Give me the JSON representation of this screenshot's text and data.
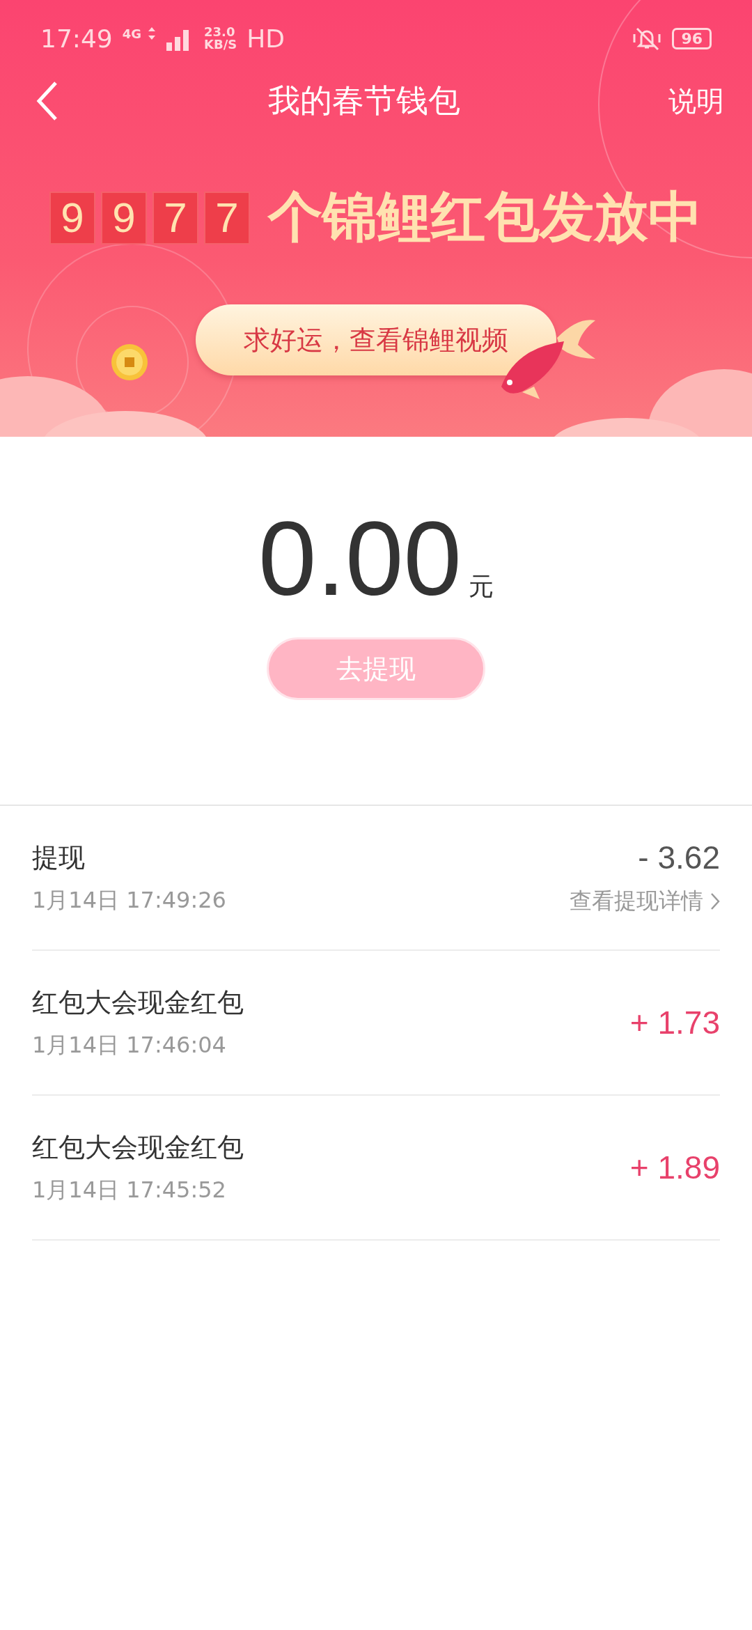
{
  "status_bar": {
    "time": "17:49",
    "network": "4G",
    "speed_value": "23.0",
    "speed_unit": "KB/S",
    "hd": "HD",
    "battery": "96"
  },
  "header": {
    "title": "我的春节钱包",
    "help": "说明"
  },
  "banner": {
    "digits": [
      "9",
      "9",
      "7",
      "7"
    ],
    "headline": "个锦鲤红包发放中",
    "button": "求好运，查看锦鲤视频"
  },
  "balance": {
    "amount": "0.00",
    "unit": "元",
    "withdraw_button": "去提现",
    "withdraw_disabled": true
  },
  "transactions": [
    {
      "title": "提现",
      "time": "1月14日 17:49:26",
      "amount": "- 3.62",
      "kind": "debit",
      "detail_link": "查看提现详情"
    },
    {
      "title": "红包大会现金红包",
      "time": "1月14日 17:46:04",
      "amount": "+ 1.73",
      "kind": "credit"
    },
    {
      "title": "红包大会现金红包",
      "time": "1月14日 17:45:52",
      "amount": "+ 1.89",
      "kind": "credit"
    }
  ]
}
